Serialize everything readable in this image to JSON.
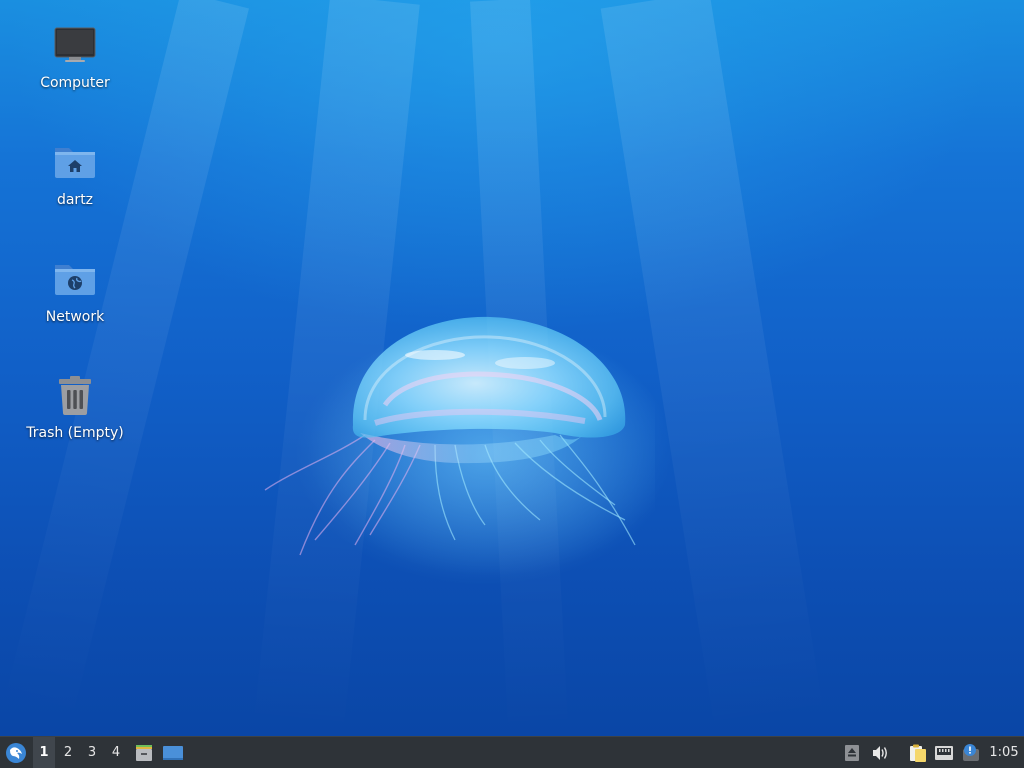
{
  "desktop": {
    "icons": [
      {
        "label": "Computer",
        "icon": "computer-icon"
      },
      {
        "label": "dartz",
        "icon": "home-folder-icon"
      },
      {
        "label": "Network",
        "icon": "network-folder-icon"
      },
      {
        "label": "Trash (Empty)",
        "icon": "trash-icon"
      }
    ],
    "wallpaper": "jellyfish-underwater"
  },
  "taskbar": {
    "menu_icon": "whisker-menu-icon",
    "workspaces": [
      "1",
      "2",
      "3",
      "4"
    ],
    "active_workspace": "1",
    "launchers": [
      "file-manager-icon",
      "show-desktop-icon"
    ],
    "tray": [
      "eject-icon",
      "volume-icon",
      "clipboard-icon",
      "network-wired-icon",
      "notification-icon"
    ],
    "clock": "1:05"
  },
  "colors": {
    "panel_bg": "#2e3338",
    "accent": "#4a90d9",
    "desktop_blue": "#1160c8"
  }
}
